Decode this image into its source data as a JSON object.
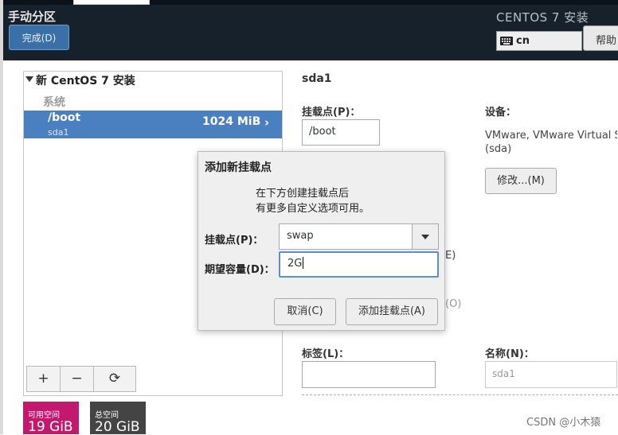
{
  "header": {
    "screen_title": "手动分区",
    "done_button": "完成(D)",
    "product_title": "CENTOS 7 安装",
    "keyboard_layout": "cn",
    "help_button": "帮助"
  },
  "left_panel": {
    "tree_title": "新 CentOS 7 安装",
    "group_label": "系统",
    "selected_partition": {
      "mount": "/boot",
      "device": "sda1",
      "size": "1024 MiB"
    },
    "toolbar": {
      "add": "+",
      "remove": "−",
      "refresh": "⟳"
    },
    "available_space": {
      "label": "可用空间",
      "value": "19 GiB"
    },
    "total_space": {
      "label": "总空间",
      "value": "20 GiB"
    }
  },
  "detail": {
    "title": "sda1",
    "mount_point_label": "挂载点(P)：",
    "mount_point_value": "/boot",
    "device_label": "设备：",
    "device_value_line1": "VMware, VMware Virtual S",
    "device_value_line2": "(sda)",
    "modify_button": "修改...(M)",
    "peek_e": "E)",
    "peek_o": "(O)",
    "label_label": "标签(L)：",
    "label_value": "",
    "name_label": "名称(N)：",
    "name_value": "sda1"
  },
  "dialog": {
    "title": "添加新挂载点",
    "info_line1": "在下方创建挂载点后",
    "info_line2": "有更多自定义选项可用。",
    "mount_point_label": "挂载点(P)：",
    "mount_point_value": "swap",
    "capacity_label": "期望容量(D)：",
    "capacity_value": "2G",
    "cancel_button": "取消(C)",
    "add_button": "添加挂载点(A)"
  },
  "watermark": "CSDN @小木猿",
  "colors": {
    "header_bg": "#17212b",
    "selection": "#4a80c0",
    "available_space": "#c2196f",
    "total_space": "#444444",
    "focus_ring": "#5b8fd0"
  }
}
